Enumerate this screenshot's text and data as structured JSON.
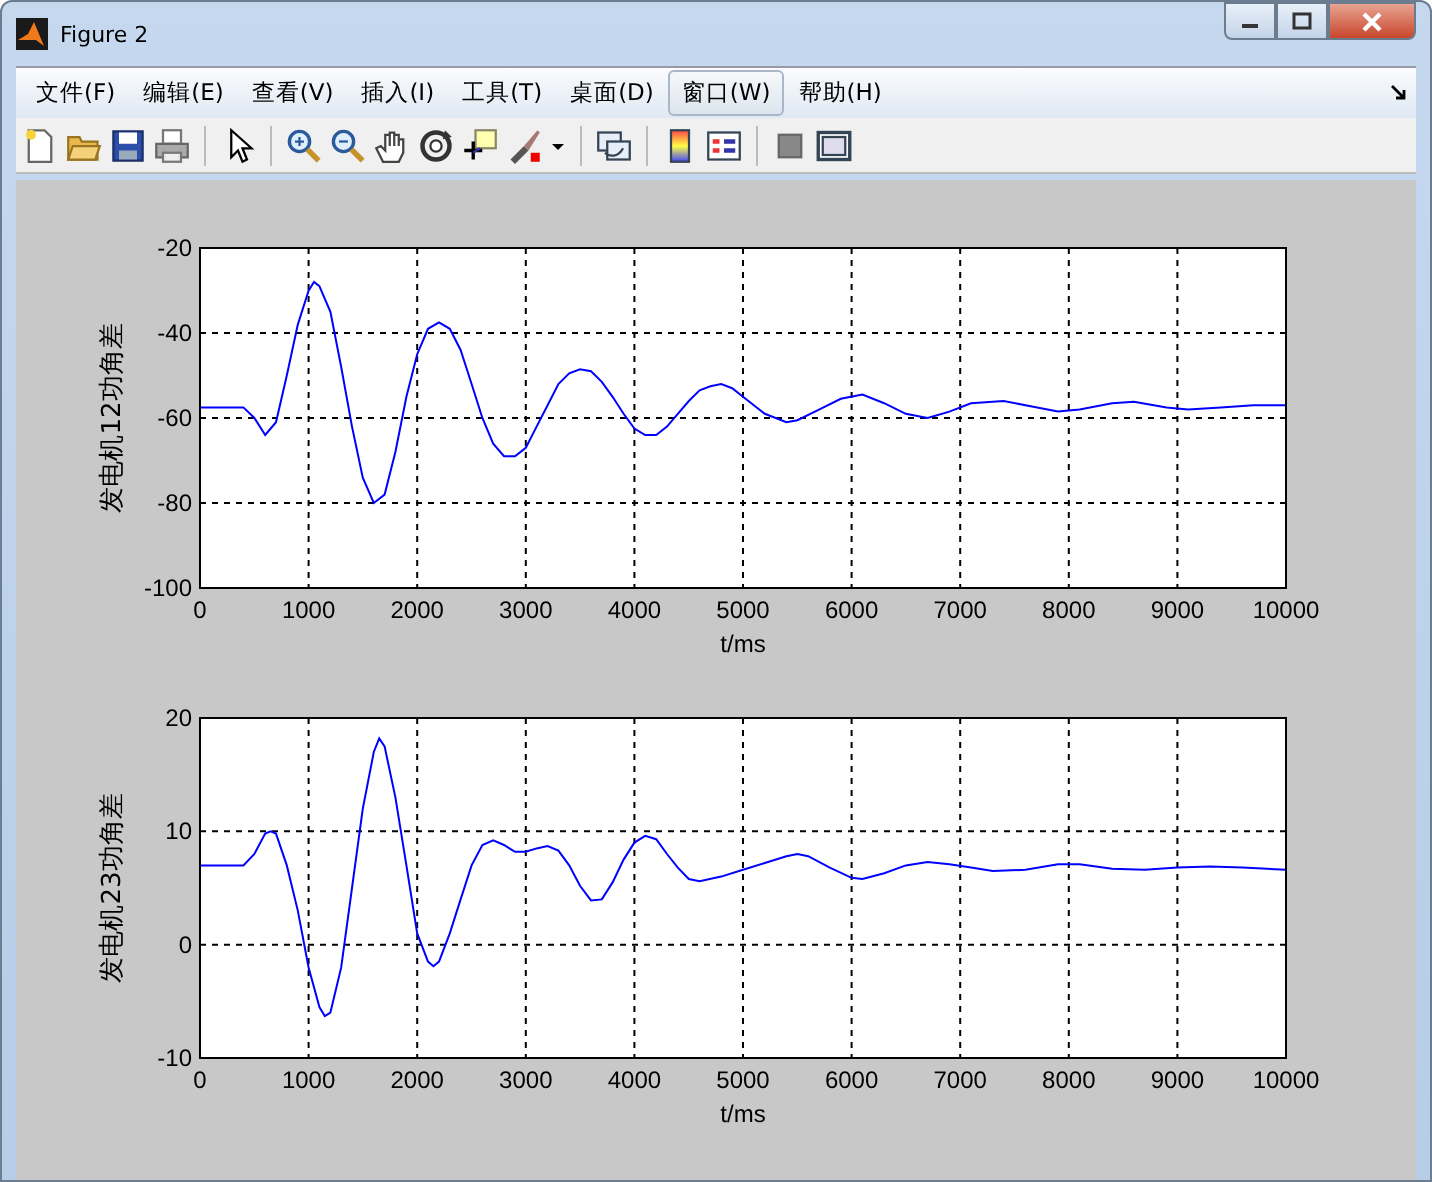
{
  "window": {
    "title": "Figure 2"
  },
  "menu": [
    {
      "label": "文件(F)",
      "selected": false
    },
    {
      "label": "编辑(E)",
      "selected": false
    },
    {
      "label": "查看(V)",
      "selected": false
    },
    {
      "label": "插入(I)",
      "selected": false
    },
    {
      "label": "工具(T)",
      "selected": false
    },
    {
      "label": "桌面(D)",
      "selected": false
    },
    {
      "label": "窗口(W)",
      "selected": true
    },
    {
      "label": "帮助(H)",
      "selected": false
    }
  ],
  "figure": {
    "axes": [
      {
        "chart_data": {
          "type": "line",
          "grid": true,
          "xlabel": "t/ms",
          "ylabel": "发电机12功角差",
          "xlim": [
            0,
            10000
          ],
          "ylim": [
            -100,
            -20
          ],
          "xticks": [
            0,
            1000,
            2000,
            3000,
            4000,
            5000,
            6000,
            7000,
            8000,
            9000,
            10000
          ],
          "yticks": [
            -100,
            -80,
            -60,
            -40,
            -20
          ],
          "x": [
            0,
            400,
            500,
            600,
            700,
            800,
            900,
            1000,
            1050,
            1100,
            1200,
            1300,
            1400,
            1500,
            1600,
            1700,
            1800,
            1900,
            2000,
            2100,
            2200,
            2300,
            2400,
            2500,
            2600,
            2700,
            2800,
            2900,
            3000,
            3100,
            3200,
            3300,
            3400,
            3500,
            3600,
            3700,
            3800,
            3900,
            4000,
            4100,
            4200,
            4300,
            4400,
            4500,
            4600,
            4700,
            4800,
            4900,
            5000,
            5200,
            5400,
            5500,
            5700,
            5900,
            6100,
            6300,
            6500,
            6700,
            6900,
            7100,
            7400,
            7600,
            7900,
            8100,
            8400,
            8600,
            8900,
            9100,
            9400,
            9700,
            10000
          ],
          "series": [
            {
              "color": "#0000ff",
              "values": [
                -57.5,
                -57.5,
                -60,
                -64,
                -61,
                -50,
                -38,
                -30,
                -28,
                -29,
                -35,
                -48,
                -62,
                -74,
                -80,
                -78,
                -68,
                -55,
                -45,
                -39,
                -37.5,
                -39,
                -44,
                -52,
                -60,
                -66,
                -69,
                -69,
                -67,
                -62,
                -57,
                -52,
                -49.5,
                -48.5,
                -49,
                -51.5,
                -55,
                -59,
                -62.5,
                -64,
                -64,
                -62,
                -59,
                -56,
                -53.5,
                -52.5,
                -52,
                -53,
                -55,
                -59,
                -61,
                -60.5,
                -58,
                -55.5,
                -54.5,
                -56.5,
                -59,
                -60,
                -58.5,
                -56.5,
                -56,
                -57,
                -58.5,
                -58,
                -56.5,
                -56.2,
                -57.5,
                -58,
                -57.5,
                -57,
                -57
              ]
            }
          ]
        }
      },
      {
        "chart_data": {
          "type": "line",
          "grid": true,
          "xlabel": "t/ms",
          "ylabel": "发电机23功角差",
          "xlim": [
            0,
            10000
          ],
          "ylim": [
            -10,
            20
          ],
          "xticks": [
            0,
            1000,
            2000,
            3000,
            4000,
            5000,
            6000,
            7000,
            8000,
            9000,
            10000
          ],
          "yticks": [
            -10,
            0,
            10,
            20
          ],
          "x": [
            0,
            400,
            500,
            600,
            650,
            700,
            800,
            900,
            1000,
            1100,
            1150,
            1200,
            1300,
            1400,
            1500,
            1600,
            1650,
            1700,
            1800,
            1900,
            2000,
            2100,
            2150,
            2200,
            2300,
            2400,
            2500,
            2600,
            2700,
            2800,
            2900,
            3000,
            3100,
            3200,
            3300,
            3400,
            3500,
            3600,
            3700,
            3800,
            3900,
            4000,
            4100,
            4200,
            4300,
            4400,
            4500,
            4600,
            4800,
            5000,
            5200,
            5400,
            5500,
            5600,
            5800,
            6000,
            6100,
            6300,
            6500,
            6700,
            6900,
            7100,
            7300,
            7600,
            7900,
            8100,
            8400,
            8700,
            9000,
            9300,
            9600,
            10000
          ],
          "series": [
            {
              "color": "#0000ff",
              "values": [
                7,
                7,
                8,
                9.8,
                10,
                9.8,
                7,
                3,
                -2,
                -5.5,
                -6.3,
                -6,
                -2,
                5,
                12,
                17,
                18.2,
                17.5,
                13,
                7,
                1,
                -1.5,
                -1.9,
                -1.5,
                1,
                4,
                7,
                8.8,
                9.2,
                8.8,
                8.2,
                8.2,
                8.5,
                8.7,
                8.3,
                7,
                5.2,
                3.9,
                4,
                5.5,
                7.5,
                9,
                9.6,
                9.3,
                8,
                6.8,
                5.8,
                5.6,
                6,
                6.6,
                7.2,
                7.8,
                8,
                7.8,
                6.8,
                5.9,
                5.8,
                6.3,
                7,
                7.3,
                7.1,
                6.8,
                6.5,
                6.6,
                7.1,
                7.1,
                6.7,
                6.6,
                6.8,
                6.9,
                6.8,
                6.6
              ]
            }
          ]
        }
      }
    ]
  }
}
